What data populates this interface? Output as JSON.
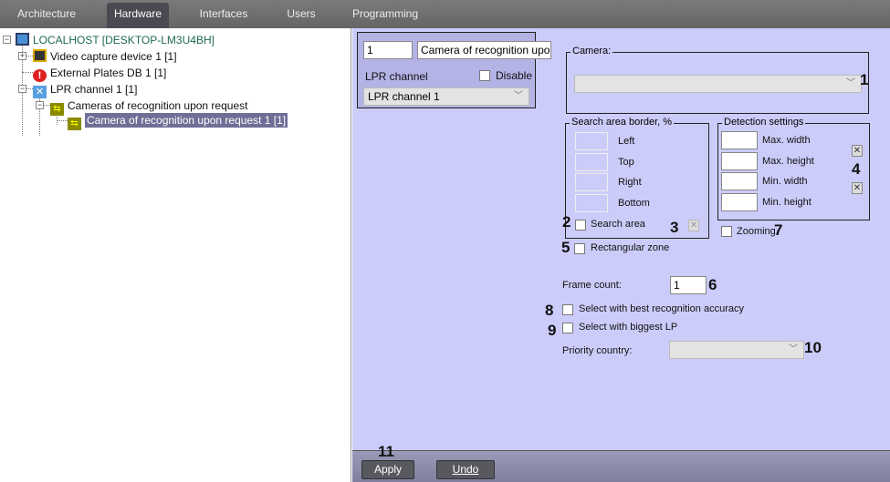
{
  "tabs": [
    {
      "label": "Architecture"
    },
    {
      "label": "Hardware",
      "active": true
    },
    {
      "label": "Interfaces"
    },
    {
      "label": "Users"
    },
    {
      "label": "Programming"
    }
  ],
  "tree": {
    "root": "LOCALHOST [DESKTOP-LM3U4BH]",
    "video": "Video capture device 1 [1]",
    "plates": "External Plates DB 1 [1]",
    "lpr": "LPR channel  1 [1]",
    "cameras": "Cameras of recognition upon request",
    "camera": "Camera of recognition upon request 1 [1]"
  },
  "header": {
    "id": "1",
    "name": "Camera of recognition upon re",
    "type_label": "LPR channel",
    "disable_label": "Disable",
    "channel_select": "LPR channel  1"
  },
  "camera_group": {
    "legend": "Camera:",
    "value": ""
  },
  "search_area": {
    "legend": "Search area border, %",
    "fields": [
      "Left",
      "Top",
      "Right",
      "Bottom"
    ],
    "checkbox": "Search area"
  },
  "detection": {
    "legend": "Detection settings",
    "fields": [
      "Max. width",
      "Max. height",
      "Min. width",
      "Min. height"
    ],
    "zooming": "Zooming"
  },
  "rect_zone": "Rectangular zone",
  "frame_count": {
    "label": "Frame count:",
    "value": "1"
  },
  "best_accuracy": "Select with best recognition accuracy",
  "biggest_lp": "Select with biggest LP",
  "priority_country": {
    "label": "Priority country:",
    "value": ""
  },
  "buttons": {
    "apply": "Apply",
    "undo": "Undo"
  },
  "callouts": [
    "1",
    "2",
    "3",
    "4",
    "5",
    "6",
    "7",
    "8",
    "9",
    "10",
    "11"
  ],
  "colors": {
    "panel": "#ccccfa",
    "selection": "#6e6e96",
    "tabbar": "#6e6e6e"
  }
}
